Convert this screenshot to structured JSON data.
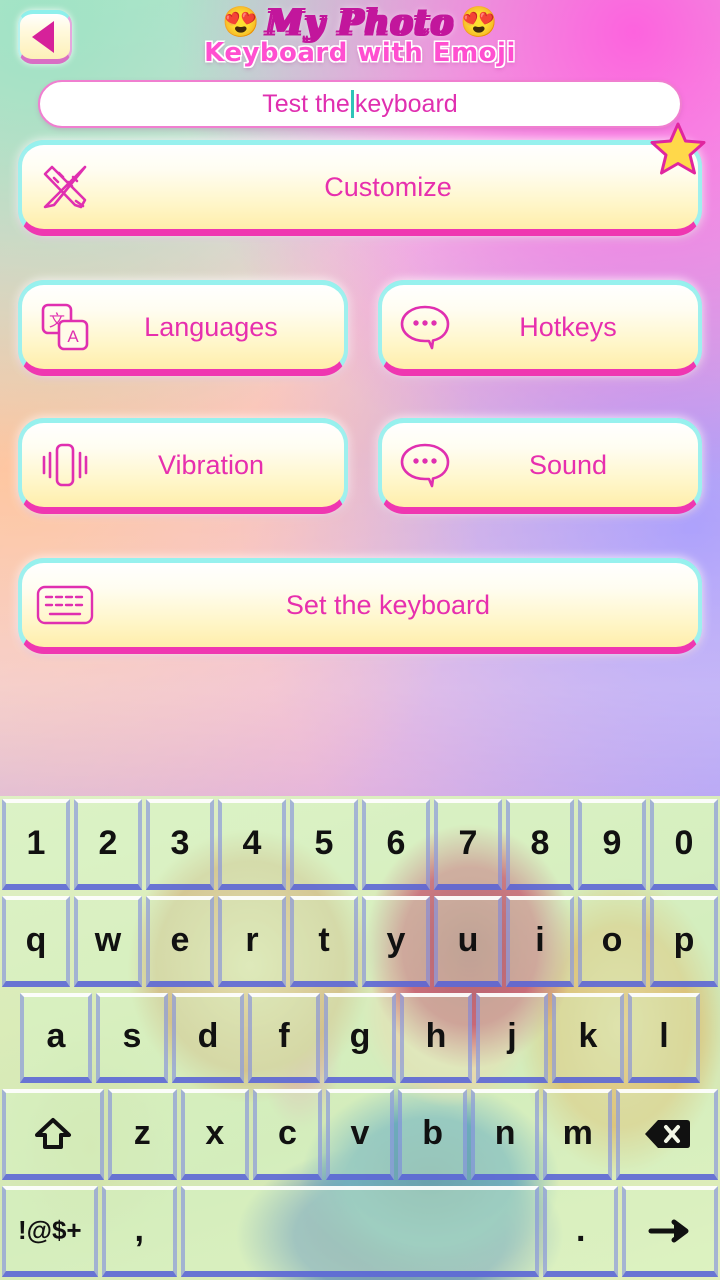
{
  "app": {
    "title_main": "My Photo",
    "title_sub": "Keyboard with Emoji",
    "emoji_left": "😍",
    "emoji_right": "😍"
  },
  "header": {
    "back_icon": "back-triangle-icon",
    "back_label": "Back"
  },
  "test_field": {
    "value": "Test the",
    "value_tail": "keyboard",
    "placeholder": "Test the keyboard"
  },
  "menu": {
    "customize": {
      "label": "Customize",
      "icon": "ruler-pencil-icon",
      "badge": "star-badge"
    },
    "languages": {
      "label": "Languages",
      "icon": "translate-icon"
    },
    "hotkeys": {
      "label": "Hotkeys",
      "icon": "speech-bubble-icon"
    },
    "vibration": {
      "label": "Vibration",
      "icon": "vibration-icon"
    },
    "sound": {
      "label": "Sound",
      "icon": "speech-bubble-icon"
    },
    "set_keyboard": {
      "label": "Set the keyboard",
      "icon": "keyboard-icon"
    }
  },
  "keyboard": {
    "row_numbers": [
      "1",
      "2",
      "3",
      "4",
      "5",
      "6",
      "7",
      "8",
      "9",
      "0"
    ],
    "row_top": [
      "q",
      "w",
      "e",
      "r",
      "t",
      "y",
      "u",
      "i",
      "o",
      "p"
    ],
    "row_home": [
      "a",
      "s",
      "d",
      "f",
      "g",
      "h",
      "j",
      "k",
      "l"
    ],
    "row_bottom": [
      "z",
      "x",
      "c",
      "v",
      "b",
      "n",
      "m"
    ],
    "shift_icon": "shift-icon",
    "backspace_icon": "backspace-icon",
    "symbols_label": "!@$+",
    "comma_label": ",",
    "space_label": "",
    "period_label": ".",
    "enter_icon": "enter-arrow-icon"
  },
  "colors": {
    "accent_pink": "#e72fae",
    "accent_magenta": "#ef37b1",
    "border_cyan": "#97f1ee",
    "button_yellow": "#ffeeab",
    "caret_teal": "#2fc4b8",
    "key_border_blue": "#555fd7",
    "star_yellow": "#ffd84a"
  }
}
